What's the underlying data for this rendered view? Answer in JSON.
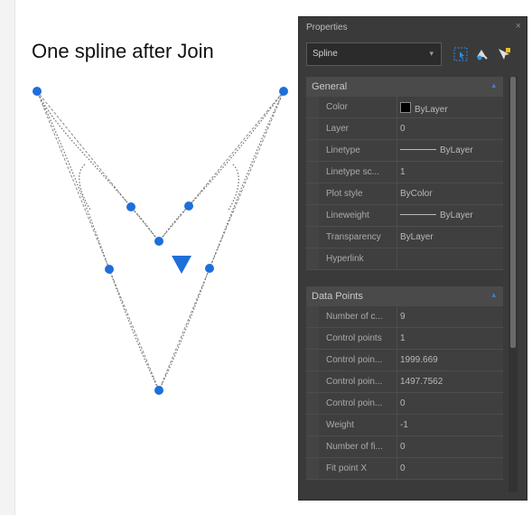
{
  "caption": "One spline after Join",
  "panel": {
    "title": "Properties",
    "close_glyph": "×",
    "selector": {
      "value": "Spline",
      "arrow": "▾"
    },
    "toolbar_icons": [
      "select-objects-icon",
      "quick-select-icon",
      "toggle-pickadd-icon"
    ],
    "sections": {
      "general": {
        "label": "General",
        "toggle": "▴",
        "rows": [
          {
            "name": "Color",
            "value": "ByLayer"
          },
          {
            "name": "Layer",
            "value": "0"
          },
          {
            "name": "Linetype",
            "value": "ByLayer"
          },
          {
            "name": "Linetype sc...",
            "value": "1"
          },
          {
            "name": "Plot style",
            "value": "ByColor"
          },
          {
            "name": "Lineweight",
            "value": "ByLayer"
          },
          {
            "name": "Transparency",
            "value": "ByLayer"
          },
          {
            "name": "Hyperlink",
            "value": ""
          }
        ]
      },
      "data_points": {
        "label": "Data Points",
        "toggle": "▴",
        "rows": [
          {
            "name": "Number of c...",
            "value": "9"
          },
          {
            "name": "Control points",
            "value": "1"
          },
          {
            "name": "Control poin...",
            "value": "1999.669"
          },
          {
            "name": "Control poin...",
            "value": "1497.7562"
          },
          {
            "name": "Control poin...",
            "value": "0"
          },
          {
            "name": "Weight",
            "value": "-1"
          },
          {
            "name": "Number of fi...",
            "value": "0"
          },
          {
            "name": "Fit point X",
            "value": "0"
          }
        ]
      }
    }
  },
  "colors": {
    "grip": "#1e6fd9",
    "spline": "#7a7a7a",
    "panel_bg": "#3a3a3a",
    "panel_text": "#aaaaaa"
  }
}
